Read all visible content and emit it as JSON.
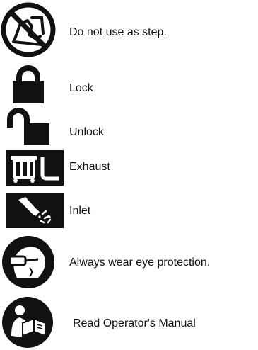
{
  "legend": {
    "items": [
      {
        "icon": "no-step-icon",
        "label": "Do not use as step."
      },
      {
        "icon": "lock-icon",
        "label": "Lock"
      },
      {
        "icon": "unlock-icon",
        "label": "Unlock"
      },
      {
        "icon": "exhaust-icon",
        "label": "Exhaust"
      },
      {
        "icon": "inlet-icon",
        "label": "Inlet"
      },
      {
        "icon": "eye-protection-icon",
        "label": "Always wear eye protection."
      },
      {
        "icon": "read-manual-icon",
        "label": "Read Operator's Manual"
      }
    ]
  },
  "colors": {
    "icon": "#111111",
    "text": "#111111",
    "background": "#ffffff"
  }
}
